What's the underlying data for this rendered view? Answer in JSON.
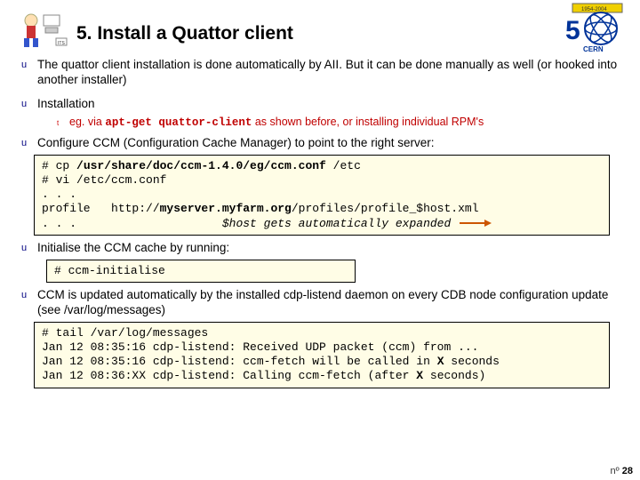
{
  "header": {
    "title": "5. Install a Quattor client"
  },
  "bullets": {
    "b1": "The quattor client installation is done automatically by AII. But it can be done manually as well (or hooked into another installer)",
    "b2": "Installation",
    "b2_sub_prefix": "eg. via ",
    "b2_sub_cmd": "apt-get quattor-client",
    "b2_sub_suffix": " as shown before, or installing individual RPM's",
    "b3": "Configure CCM (Configuration Cache Manager) to point to the right server:",
    "b4": "Initialise the CCM cache  by running:",
    "b5": "CCM is updated automatically by the installed cdp-listend daemon on every CDB node configuration update (see /var/log/messages)"
  },
  "code1": {
    "l1a": "# cp ",
    "l1b": "/usr/share/doc/ccm-1.4.0/eg/ccm.conf",
    "l1c": " /etc",
    "l2": "# vi /etc/ccm.conf",
    "l3": ". . .",
    "l4a": "profile   http://",
    "l4b": "myserver.myfarm.org",
    "l4c": "/profiles/profile_$host.xml",
    "l5": ". . .                     ",
    "note": "$host gets automatically expanded"
  },
  "code2": {
    "l1": "# ccm-initialise"
  },
  "code3": {
    "l1": "# tail /var/log/messages",
    "l2a": "Jan 12 08:35:16 cdp-listend: Received UDP packet (ccm) from ...",
    "l3a": "Jan 12 08:35:16 cdp-listend: ccm-fetch will be called in ",
    "l3b": "X",
    "l3c": " seconds",
    "l4a": "Jan 12 08:36:XX cdp-listend: Calling ccm-fetch (after ",
    "l4b": "X",
    "l4c": " seconds)"
  },
  "footer": {
    "prefix": "nº ",
    "page": "28"
  }
}
